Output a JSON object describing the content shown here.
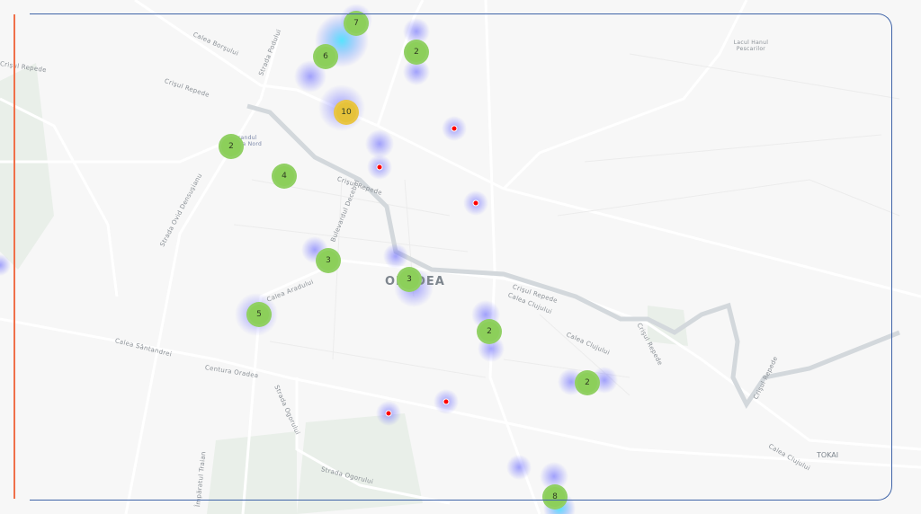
{
  "map": {
    "city_label": "ORADEA",
    "district_label": "TOKAI",
    "lake_label": "Lacul Hanul Pescarilor",
    "park_label": "Ştrandul Ioşia Nord",
    "street_labels": [
      "Calea Borşului",
      "Strada Podului",
      "Crişul Repede",
      "Crişul Repede",
      "Crişul Repede",
      "Bulevardul Decebal",
      "Strada Ovid Densuşianu",
      "Calea Aradului",
      "Calea Sântandrei",
      "Centura Oradea",
      "Strada Ogorului",
      "Strada Ogorului",
      "Calea Clujului",
      "Calea Clujului",
      "Calea Clujului",
      "Crişul Repede",
      "Crişul Repede",
      "Crişul Repede",
      "Împăratul Traian"
    ],
    "colors": {
      "cluster": "#8ccf5a",
      "cluster_large": "#e6c23a",
      "point": "#ff0000",
      "heat": "#6a6aff",
      "frame_blue": "#3f64a8",
      "frame_orange": "#f0704a"
    },
    "clusters": [
      {
        "count": "7"
      },
      {
        "count": "6"
      },
      {
        "count": "2"
      },
      {
        "count": "10",
        "large": true
      },
      {
        "count": "2"
      },
      {
        "count": "4"
      },
      {
        "count": "3"
      },
      {
        "count": "3"
      },
      {
        "count": "5"
      },
      {
        "count": "2"
      },
      {
        "count": "2"
      },
      {
        "count": "8"
      }
    ],
    "single_points": 5
  }
}
